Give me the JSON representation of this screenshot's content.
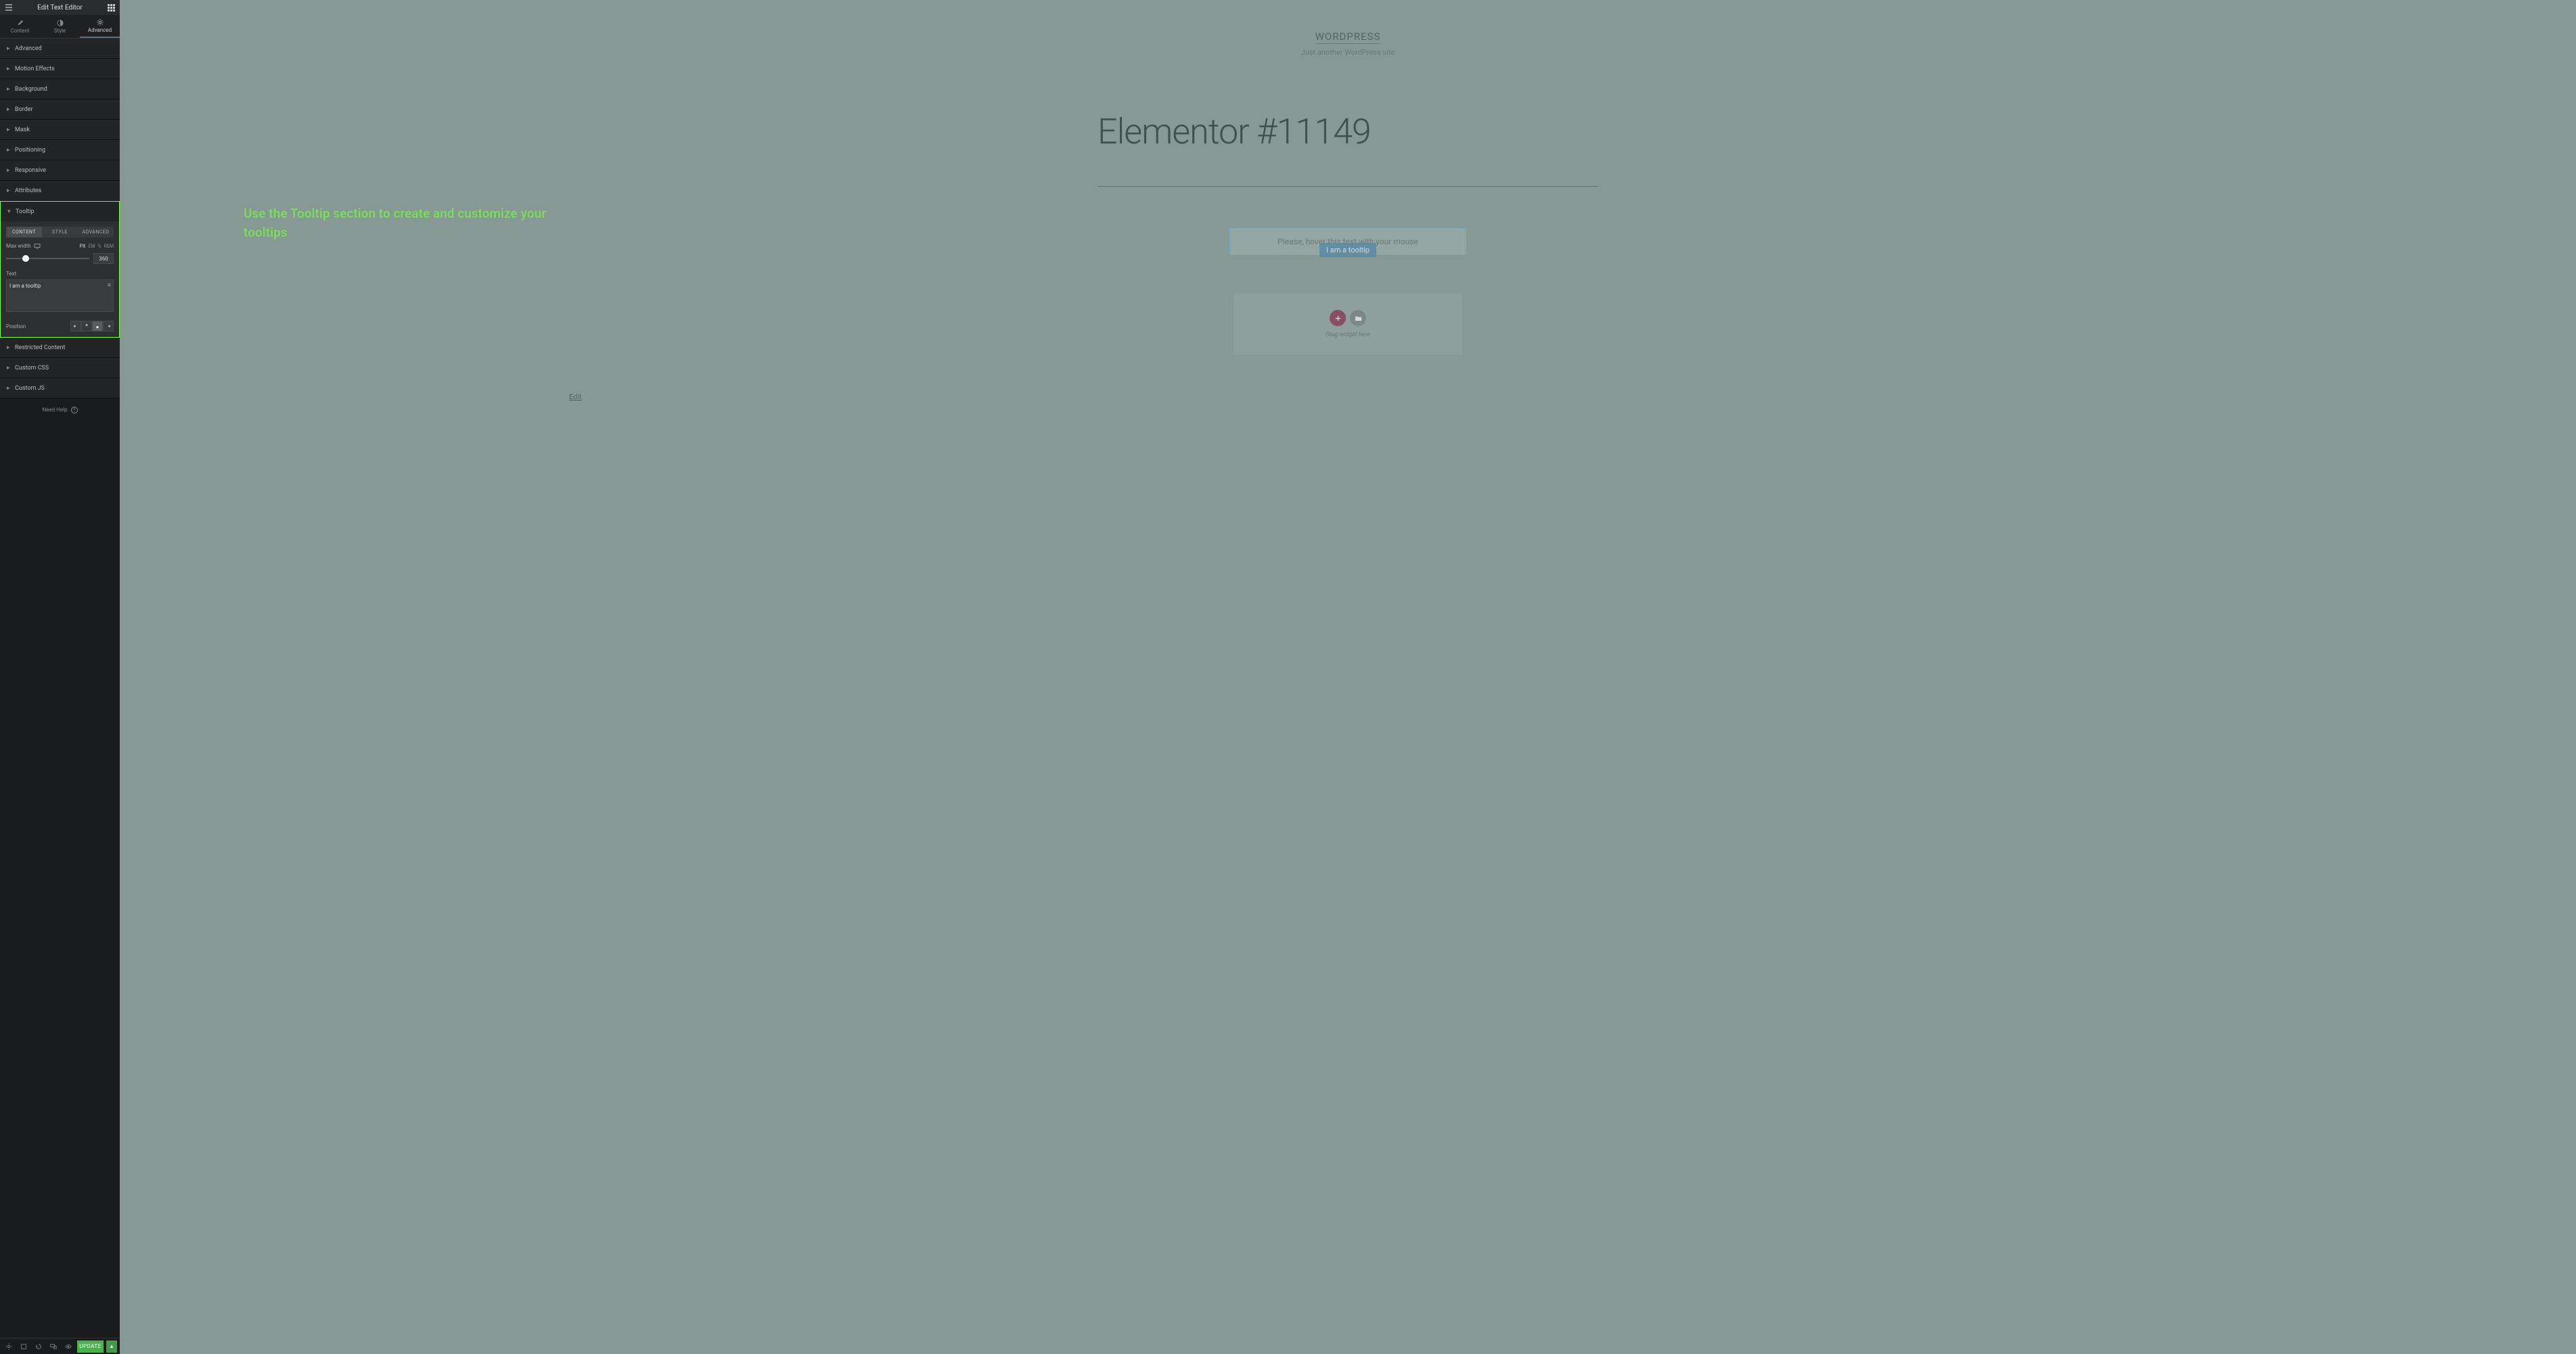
{
  "sidebar": {
    "title": "Edit Text Editor",
    "tabs": [
      {
        "label": "Content",
        "icon": "pencil-icon"
      },
      {
        "label": "Style",
        "icon": "contrast-icon"
      },
      {
        "label": "Advanced",
        "icon": "gear-icon"
      }
    ],
    "accordion": [
      {
        "label": "Advanced"
      },
      {
        "label": "Motion Effects"
      },
      {
        "label": "Background"
      },
      {
        "label": "Border"
      },
      {
        "label": "Mask"
      },
      {
        "label": "Positioning"
      },
      {
        "label": "Responsive"
      },
      {
        "label": "Attributes"
      }
    ],
    "tooltip_section": {
      "label": "Tooltip",
      "subtabs": [
        "CONTENT",
        "STYLE",
        "ADVANCED"
      ],
      "max_width_label": "Max width",
      "units": [
        "PX",
        "EM",
        "%",
        "REM"
      ],
      "max_width_value": "360",
      "text_label": "Text",
      "text_value": "I am a tooltip",
      "position_label": "Position"
    },
    "accordion_after": [
      {
        "label": "Restricted Content"
      },
      {
        "label": "Custom CSS"
      },
      {
        "label": "Custom JS"
      }
    ],
    "help_text": "Need Help",
    "update_label": "UPDATE"
  },
  "canvas": {
    "annotation": "Use the Tooltip section to create and customize your tooltips",
    "site_title": "WORDPRESS",
    "tagline": "Just another WordPress site",
    "page_title": "Elementor #11149",
    "hover_text": "Please, hover this text with your mouse",
    "tooltip_text": "I am a tooltip",
    "drop_label": "Drag widget here",
    "edit_link": "Edit"
  }
}
